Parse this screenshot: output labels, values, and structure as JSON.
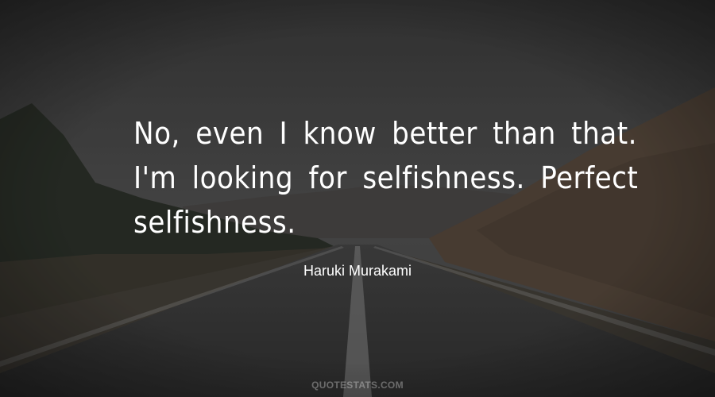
{
  "quote": {
    "text": "No, even I know better than that. I'm looking for selfishness. Perfect selfishness."
  },
  "author": {
    "name": "Haruki Murakami"
  },
  "watermark": {
    "text": "QUOTESTATS.COM"
  },
  "colors": {
    "sky": "#4a4a4a",
    "hill": "#5c4a3a",
    "road": "#3a3a3a",
    "text": "#ffffff"
  }
}
